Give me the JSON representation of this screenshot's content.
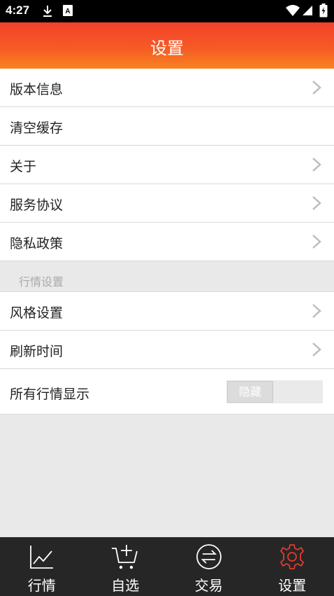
{
  "status_bar": {
    "time": "4:27",
    "icons": [
      "download-icon",
      "font-app-icon",
      "wifi-icon",
      "signal-icon",
      "battery-icon"
    ]
  },
  "header": {
    "title": "设置"
  },
  "menu": {
    "items": [
      {
        "label": "版本信息",
        "has_chevron": true
      },
      {
        "label": "清空缓存",
        "has_chevron": false
      },
      {
        "label": "关于",
        "has_chevron": true
      },
      {
        "label": "服务协议",
        "has_chevron": true
      },
      {
        "label": "隐私政策",
        "has_chevron": true
      }
    ],
    "section_title": "行情设置",
    "section_items": [
      {
        "label": "风格设置",
        "has_chevron": true
      },
      {
        "label": "刷新时间",
        "has_chevron": true
      }
    ],
    "toggle_row": {
      "label": "所有行情显示",
      "toggle_text": "隐藏"
    }
  },
  "tabbar": {
    "tabs": [
      {
        "label": "行情",
        "icon": "chart-icon"
      },
      {
        "label": "自选",
        "icon": "cart-add-icon"
      },
      {
        "label": "交易",
        "icon": "exchange-icon"
      },
      {
        "label": "设置",
        "icon": "gear-icon",
        "active": true
      }
    ],
    "active_color": "#e23b2e"
  }
}
